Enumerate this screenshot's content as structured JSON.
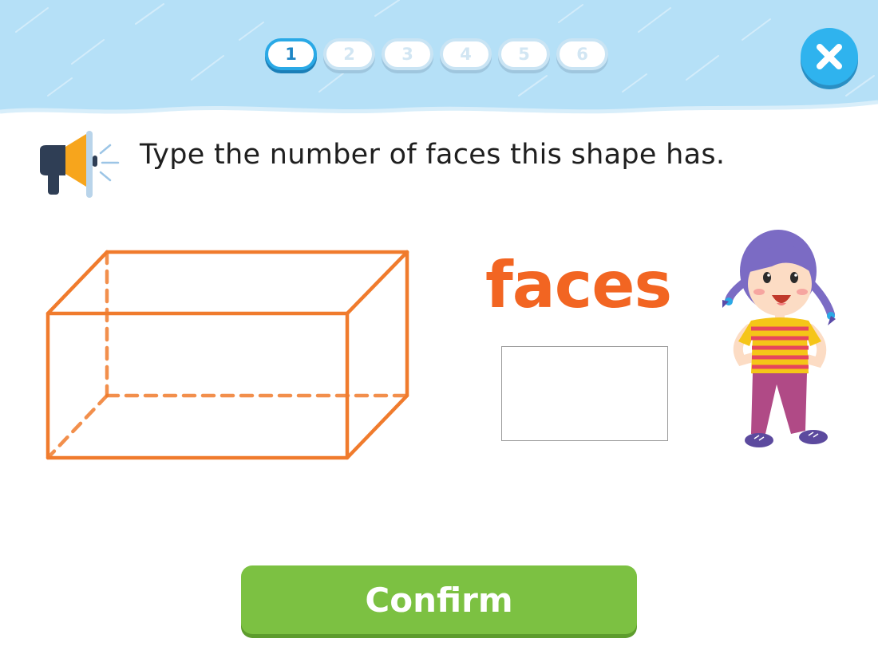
{
  "header": {
    "steps": [
      "1",
      "2",
      "3",
      "4",
      "5",
      "6"
    ],
    "current_step": 1,
    "close_icon": "close-icon"
  },
  "question": {
    "speaker_icon": "megaphone-icon",
    "prompt": "Type the number of faces this shape has.",
    "shape": "rectangular prism",
    "label": "faces",
    "answer_value": ""
  },
  "footer": {
    "confirm_label": "Confirm"
  },
  "colors": {
    "sky": "#b5e0f7",
    "accent_orange": "#f26522",
    "confirm_green": "#7cc142",
    "step_active": "#2aa9e6"
  }
}
